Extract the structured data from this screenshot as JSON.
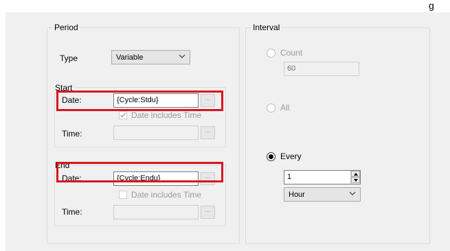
{
  "colors": {
    "dialog_bg": "#f0f0f0",
    "highlight": "#d9141e",
    "disabled_text": "#9a9a9a"
  },
  "period": {
    "legend": "Period",
    "type_label": "Type",
    "type_value": "Variable",
    "start": {
      "legend": "Start",
      "date_label": "Date:",
      "date_value": "{Cycle:Stdu}",
      "browse_label": "...",
      "includes_time_label": "Date includes Time",
      "includes_time_checked": true,
      "time_label": "Time:",
      "time_value": "",
      "time_browse_label": "..."
    },
    "end": {
      "legend": "End",
      "date_label": "Date:",
      "date_value": "{Cycle:Endu}",
      "browse_label": "...",
      "includes_time_label": "Date includes Time",
      "includes_time_checked": false,
      "time_label": "Time:",
      "time_value": "",
      "time_browse_label": "..."
    }
  },
  "interval": {
    "legend": "Interval",
    "count_label": "Count",
    "count_value": "60",
    "all_label": "All",
    "every_label": "Every",
    "every_selected": true,
    "every_value": "1",
    "unit_value": "Hour"
  },
  "icons": {
    "combo_arrow": "chevron-down-icon",
    "spin_up": "spin-up-icon",
    "spin_down": "spin-down-icon",
    "check": "checkmark-icon"
  }
}
